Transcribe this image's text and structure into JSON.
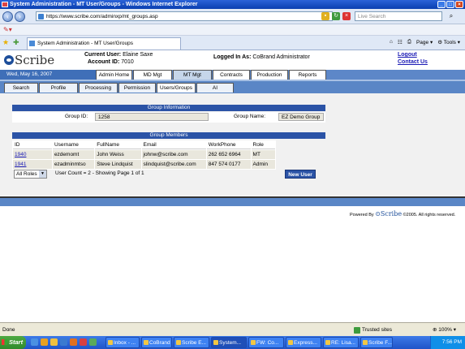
{
  "window": {
    "title": "System Administration - MT User/Groups - Windows Internet Explorer"
  },
  "browser": {
    "url": "https://www.scribe.com/adminxp/mt_groups.asp",
    "search_placeholder": "Live Search",
    "tab_title": "System Administration - MT User/Groups",
    "tools": {
      "page": "Page",
      "tools": "Tools"
    }
  },
  "header": {
    "logo_text": "Scribe",
    "current_user_label": "Current User:",
    "current_user": "Elaine Saxe",
    "account_id_label": "Account ID:",
    "account_id": "7010",
    "logged_in_label": "Logged In As:",
    "logged_in_as": "CoBrand Administrator",
    "logout": "Logout",
    "contact": "Contact Us",
    "date": "Wed, May 16, 2007"
  },
  "main_tabs": [
    {
      "label": "Admin Home"
    },
    {
      "label": "MD Mgt"
    },
    {
      "label": "MT Mgt"
    },
    {
      "label": "Contracts"
    },
    {
      "label": "Production"
    },
    {
      "label": "Reports"
    }
  ],
  "sub_tabs": [
    {
      "label": "Search"
    },
    {
      "label": "Profile"
    },
    {
      "label": "Processing"
    },
    {
      "label": "Permission"
    },
    {
      "label": "Users/Groups"
    },
    {
      "label": "AI"
    }
  ],
  "group_info": {
    "header": "Group Information",
    "group_id_label": "Group ID:",
    "group_id": "1258",
    "group_name_label": "Group Name:",
    "group_name": "EZ Demo Group"
  },
  "members": {
    "header": "Group Members",
    "columns": [
      "ID",
      "Username",
      "FullName",
      "Email",
      "WorkPhone",
      "Role"
    ],
    "rows": [
      [
        "1940",
        "ezdemomt",
        "John Weiss",
        "johnw@scribe.com",
        "262 652 6964",
        "MT"
      ],
      [
        "1941",
        "ezadminmtso",
        "Steve Lindquist",
        "slindquist@scribe.com",
        "847 574 0177",
        "Admin"
      ]
    ],
    "role_filter": "All Roles",
    "count_text": "User Count = 2 - Showing Page 1 of 1",
    "new_user": "New User"
  },
  "footer": {
    "powered_by": "Powered By",
    "brand": "Scribe",
    "copyright": "©2005. All rights reserved."
  },
  "status": {
    "done": "Done",
    "zone": "Trusted sites",
    "zoom": "100%"
  },
  "taskbar": {
    "start": "Start",
    "tasks": [
      "Inbox - ...",
      "CoBrand",
      "Scribe E...",
      "System...",
      "FW: Co...",
      "Express...",
      "RE: Lisa...",
      "Scribe F..."
    ],
    "clock": "7:56 PM"
  }
}
